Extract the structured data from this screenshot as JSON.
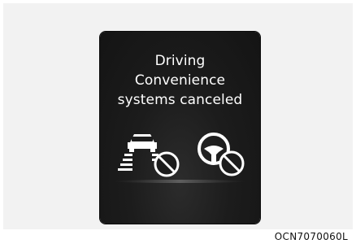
{
  "message": {
    "line1": "Driving",
    "line2": "Convenience",
    "line3": "systems canceled"
  },
  "icons": [
    "lane-departure-disabled-icon",
    "steering-assist-disabled-icon"
  ],
  "caption": "OCN7070060L",
  "colors": {
    "display_bg": "#1a1a1a",
    "text": "#ffffff",
    "frame_bg": "#f2f2f2"
  }
}
